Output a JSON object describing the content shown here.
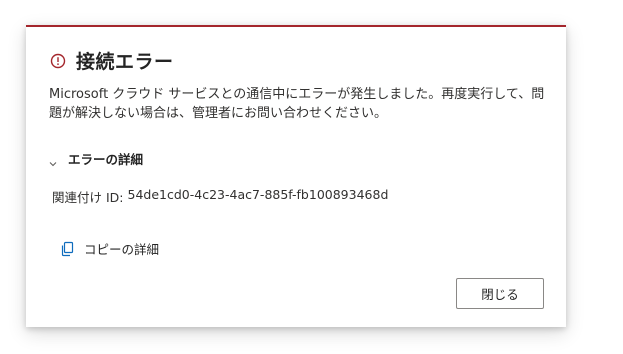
{
  "dialog": {
    "title": "接続エラー",
    "message": "Microsoft クラウド サービスとの通信中にエラーが発生しました。再度実行して、問題が解決しない場合は、管理者にお問い合わせください。",
    "details_toggle_label": "エラーの詳細",
    "correlation_label": "関連付け ID:",
    "correlation_id": "54de1cd0-4c23-4ac7-885f-fb100893468d",
    "copy_details_label": "コピーの詳細",
    "close_button_label": "閉じる"
  },
  "colors": {
    "error_accent": "#a4262c",
    "link_icon": "#0f6cbd",
    "text": "#242424"
  },
  "icons": {
    "error": "error-circle-icon",
    "chevron": "chevron-down-icon",
    "copy": "copy-icon"
  }
}
